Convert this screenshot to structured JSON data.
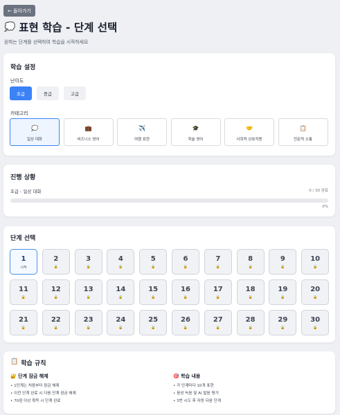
{
  "back_button": {
    "label": "← 돌아가기"
  },
  "page": {
    "icon": "💭",
    "title": "표현 학습 - 단계 선택",
    "subtitle": "원하는 단계를 선택하여 학습을 시작하세요"
  },
  "settings": {
    "title": "학습 설정",
    "difficulty_label": "난이도",
    "difficulties": [
      {
        "label": "초급",
        "active": true
      },
      {
        "label": "중급",
        "active": false
      },
      {
        "label": "고급",
        "active": false
      }
    ],
    "category_label": "카테고리",
    "categories": [
      {
        "icon": "💭",
        "label": "일상 대화",
        "active": true
      },
      {
        "icon": "💼",
        "label": "비즈니스 영어",
        "active": false
      },
      {
        "icon": "✈️",
        "label": "여행 표현",
        "active": false
      },
      {
        "icon": "🎓",
        "label": "학술 영어",
        "active": false
      },
      {
        "icon": "🤝",
        "label": "사회적 상호작용",
        "active": false
      },
      {
        "icon": "📋",
        "label": "전문적 소통",
        "active": false
      }
    ]
  },
  "progress": {
    "title": "진행 상황",
    "current": "초급 - 일상 대화",
    "count": "0 / 30 완료",
    "percent_label": "0%",
    "fraction": 0
  },
  "stages": {
    "title": "단계 선택",
    "items": [
      {
        "n": "1",
        "sub": "시작",
        "active": true
      },
      {
        "n": "2",
        "sub": "🔒"
      },
      {
        "n": "3",
        "sub": "🔒"
      },
      {
        "n": "4",
        "sub": "🔒"
      },
      {
        "n": "5",
        "sub": "🔒"
      },
      {
        "n": "6",
        "sub": "🔒"
      },
      {
        "n": "7",
        "sub": "🔒"
      },
      {
        "n": "8",
        "sub": "🔒"
      },
      {
        "n": "9",
        "sub": "🔒"
      },
      {
        "n": "10",
        "sub": "🔒"
      },
      {
        "n": "11",
        "sub": "🔒"
      },
      {
        "n": "12",
        "sub": "🔒"
      },
      {
        "n": "13",
        "sub": "🔒"
      },
      {
        "n": "14",
        "sub": "🔒"
      },
      {
        "n": "15",
        "sub": "🔒"
      },
      {
        "n": "16",
        "sub": "🔒"
      },
      {
        "n": "17",
        "sub": "🔒"
      },
      {
        "n": "18",
        "sub": "🔒"
      },
      {
        "n": "19",
        "sub": "🔒"
      },
      {
        "n": "20",
        "sub": "🔒"
      },
      {
        "n": "21",
        "sub": "🔒"
      },
      {
        "n": "22",
        "sub": "🔒"
      },
      {
        "n": "23",
        "sub": "🔒"
      },
      {
        "n": "24",
        "sub": "🔒"
      },
      {
        "n": "25",
        "sub": "🔒"
      },
      {
        "n": "26",
        "sub": "🔒"
      },
      {
        "n": "27",
        "sub": "🔒"
      },
      {
        "n": "28",
        "sub": "🔒"
      },
      {
        "n": "29",
        "sub": "🔒"
      },
      {
        "n": "30",
        "sub": "🔒"
      }
    ]
  },
  "rules": {
    "icon": "📋",
    "title": "학습 규칙",
    "unlock": {
      "icon": "🔐",
      "title": "단계 잠금 해제",
      "items": [
        "• 1단계는 처음부터 잠금 해제",
        "• 이전 단계 완료 시 다음 단계 잠금 해제",
        "• 70점 이상 획득 시 단계 완료"
      ]
    },
    "content": {
      "icon": "🎯",
      "title": "학습 내용",
      "items": [
        "• 각 단계마다 10개 표현",
        "• 음성 녹음 및 AI 발음 평가",
        "• 3번 시도 후 자동 다음 단계"
      ]
    }
  }
}
